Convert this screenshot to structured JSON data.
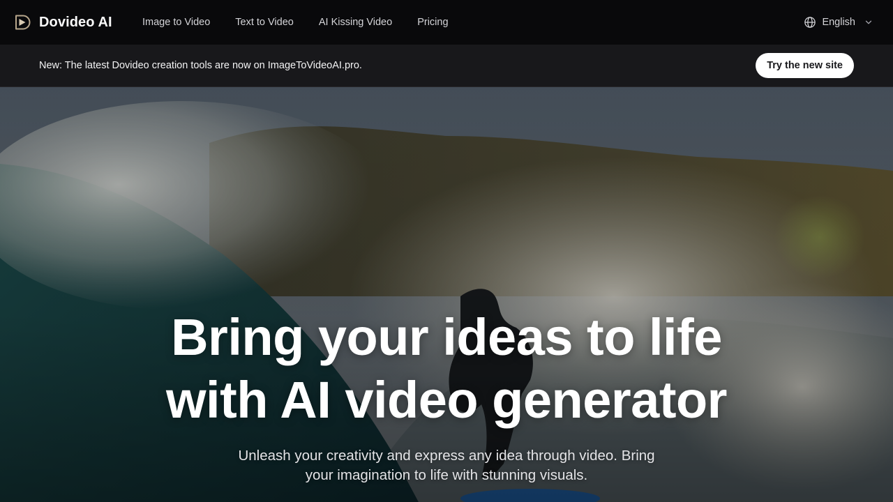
{
  "brand": {
    "name": "Dovideo AI",
    "logo_icon": "play-d-logo-icon",
    "logo_colors": {
      "outline": "#b8a78c",
      "fill": "#d9cbb3"
    }
  },
  "nav": {
    "links": [
      {
        "label": "Image to Video"
      },
      {
        "label": "Text to Video"
      },
      {
        "label": "AI Kissing Video"
      },
      {
        "label": "Pricing"
      }
    ],
    "language": {
      "label": "English",
      "icon": "globe-icon",
      "dropdown_icon": "chevron-down-icon"
    }
  },
  "announcement": {
    "text": "New: The latest Dovideo creation tools are now on ImageToVideoAI.pro.",
    "button_label": "Try the new site"
  },
  "hero": {
    "background_image": "surfer riding a large wave with hills in background",
    "title_line1": "Bring your ideas to life",
    "title_line2": "with AI video generator",
    "subtitle_line1": "Unleash your creativity and express any idea through video. Bring",
    "subtitle_line2": "your imagination to life with stunning visuals."
  },
  "colors": {
    "nav_bg": "#09090b",
    "announce_bg": "#18181b",
    "button_bg": "#ffffff",
    "button_text": "#18181b",
    "nav_text": "#d4d4d8",
    "hero_title": "#ffffff"
  }
}
